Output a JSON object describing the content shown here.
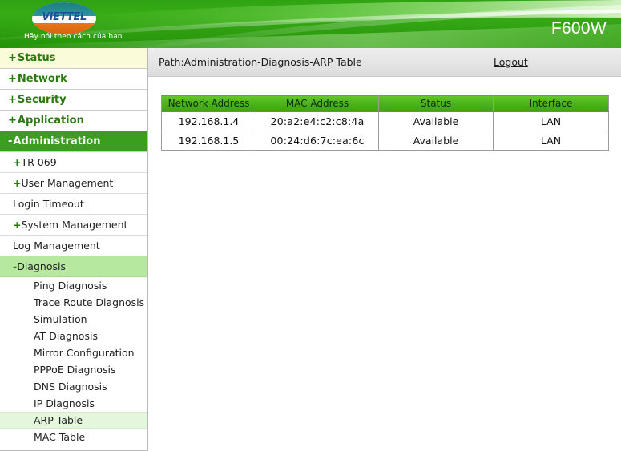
{
  "header": {
    "brand": "VIETTEL",
    "tagline": "Hãy nói theo cách của bạn",
    "model": "F600W"
  },
  "sidebar": {
    "top_items": [
      {
        "sign": "+",
        "label": "Status",
        "state": "first"
      },
      {
        "sign": "+",
        "label": "Network",
        "state": "normal"
      },
      {
        "sign": "+",
        "label": "Security",
        "state": "normal"
      },
      {
        "sign": "+",
        "label": "Application",
        "state": "normal"
      },
      {
        "sign": "-",
        "label": "Administration",
        "state": "active"
      }
    ],
    "sub_items": [
      {
        "sign": "+",
        "label": "TR-069",
        "state": "normal"
      },
      {
        "sign": "+",
        "label": "User Management",
        "state": "normal"
      },
      {
        "sign": "",
        "label": "Login Timeout",
        "state": "normal"
      },
      {
        "sign": "+",
        "label": "System Management",
        "state": "normal"
      },
      {
        "sign": "",
        "label": "Log Management",
        "state": "normal"
      },
      {
        "sign": "-",
        "label": "Diagnosis",
        "state": "open"
      }
    ],
    "leaf_items": [
      {
        "label": "Ping Diagnosis",
        "state": "normal"
      },
      {
        "label": "Trace Route Diagnosis",
        "state": "normal"
      },
      {
        "label": "Simulation",
        "state": "normal"
      },
      {
        "label": "AT Diagnosis",
        "state": "normal"
      },
      {
        "label": "Mirror Configuration",
        "state": "normal"
      },
      {
        "label": "PPPoE Diagnosis",
        "state": "normal"
      },
      {
        "label": "DNS Diagnosis",
        "state": "normal"
      },
      {
        "label": "IP Diagnosis",
        "state": "normal"
      },
      {
        "label": "ARP Table",
        "state": "selected"
      },
      {
        "label": "MAC Table",
        "state": "normal"
      }
    ]
  },
  "pathbar": {
    "path": "Path:Administration-Diagnosis-ARP Table",
    "logout_label": "Logout"
  },
  "arp_table": {
    "columns": [
      "Network Address",
      "MAC Address",
      "Status",
      "Interface"
    ],
    "rows": [
      {
        "network_address": "192.168.1.4",
        "mac_address": "20:a2:e4:c2:c8:4a",
        "status": "Available",
        "interface": "LAN"
      },
      {
        "network_address": "192.168.1.5",
        "mac_address": "00:24:d6:7c:ea:6c",
        "status": "Available",
        "interface": "LAN"
      }
    ]
  },
  "colors": {
    "banner_green": "#37ac15",
    "active_nav": "#3a9e1e",
    "open_nav": "#b7e8a0",
    "selected_leaf": "#e4f7dc",
    "table_header_green": "#4cb51c",
    "pathbar_gray": "#e4e4e4",
    "brand_blue": "#1b4f9c",
    "logo_teal": "#2a95a0",
    "logo_orange": "#e8761a"
  }
}
